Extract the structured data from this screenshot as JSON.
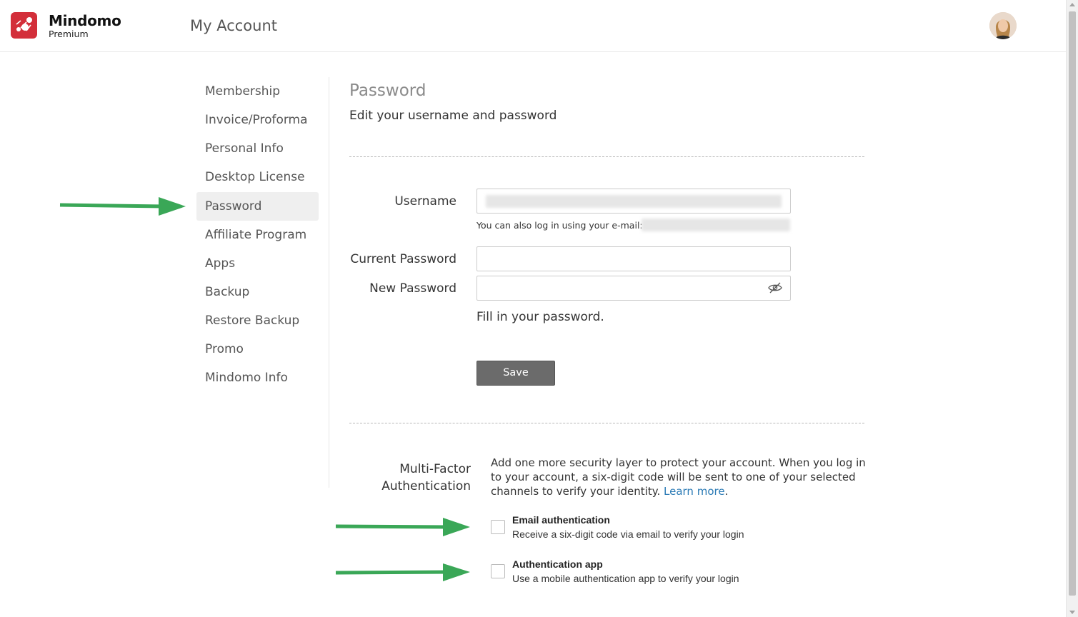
{
  "header": {
    "brand": "Mindomo",
    "brand_tier": "Premium",
    "page_title": "My Account"
  },
  "sidebar": {
    "items": [
      {
        "label": "Membership",
        "active": false
      },
      {
        "label": "Invoice/Proforma",
        "active": false
      },
      {
        "label": "Personal Info",
        "active": false
      },
      {
        "label": "Desktop License",
        "active": false
      },
      {
        "label": "Password",
        "active": true
      },
      {
        "label": "Affiliate Program",
        "active": false
      },
      {
        "label": "Apps",
        "active": false
      },
      {
        "label": "Backup",
        "active": false
      },
      {
        "label": "Restore Backup",
        "active": false
      },
      {
        "label": "Promo",
        "active": false
      },
      {
        "label": "Mindomo Info",
        "active": false
      }
    ]
  },
  "main": {
    "title": "Password",
    "subtitle": "Edit your username and password",
    "username_label": "Username",
    "username_hint": "You can also log in using your e-mail:",
    "current_password_label": "Current Password",
    "new_password_label": "New Password",
    "password_hint": "Fill in your password.",
    "save_label": "Save"
  },
  "mfa": {
    "label": "Multi-Factor Authentication",
    "description": "Add one more security layer to protect your account. When you log in to your account, a six-digit code will be sent to one of your selected channels to verify your identity.",
    "learn_more": "Learn more",
    "options": [
      {
        "title": "Email authentication",
        "description": "Receive a six-digit code via email to verify your login",
        "checked": false
      },
      {
        "title": "Authentication app",
        "description": "Use a mobile authentication app to verify your login",
        "checked": false
      }
    ]
  },
  "colors": {
    "brand_red": "#d32f3a",
    "annotation_arrow": "#3aa757",
    "link": "#2a7ab5",
    "save_button": "#6b6b6b"
  }
}
